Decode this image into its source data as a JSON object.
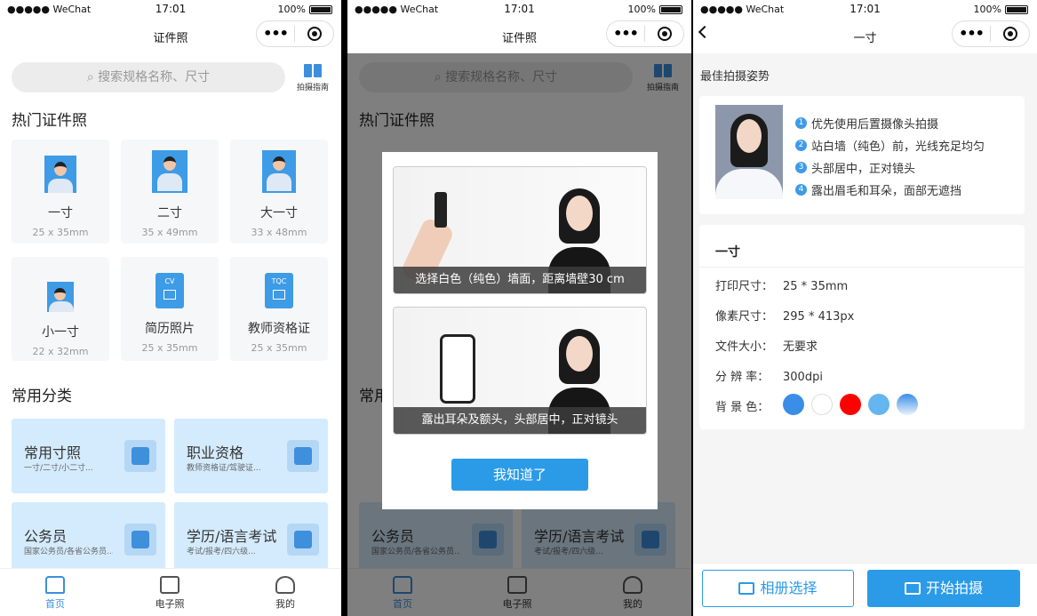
{
  "status": {
    "signal": "●●●●● WeChat",
    "time": "17:01",
    "battery": "100%"
  },
  "home": {
    "nav_title": "证件照",
    "search_placeholder": "搜索规格名称、尺寸",
    "guide_label": "拍摄指南",
    "hot_title": "热门证件照",
    "hot_items": [
      {
        "name": "一寸",
        "size": "25 x 35mm"
      },
      {
        "name": "二寸",
        "size": "35 x 49mm"
      },
      {
        "name": "大一寸",
        "size": "33 x 48mm"
      },
      {
        "name": "小一寸",
        "size": "22 x 32mm"
      },
      {
        "name": "简历照片",
        "size": "25 x 35mm",
        "badge": "CV"
      },
      {
        "name": "教师资格证",
        "size": "25 x 35mm",
        "badge": "TQC"
      }
    ],
    "cat_title": "常用分类",
    "categories": [
      {
        "title": "常用寸照",
        "sub": "一寸/二寸/小二寸..."
      },
      {
        "title": "职业资格",
        "sub": "教师资格证/驾驶证..."
      },
      {
        "title": "公务员",
        "sub": "国家公务员/各省公务员..."
      },
      {
        "title": "学历/语言考试",
        "sub": "考试/报考/四六级..."
      }
    ],
    "tabs": [
      "首页",
      "电子照",
      "我的"
    ]
  },
  "modal": {
    "caption1": "选择白色（纯色）墙面，距离墙壁30 cm",
    "caption2": "露出耳朵及额头，头部居中，正对镜头",
    "ok_label": "我知道了"
  },
  "detail": {
    "nav_title": "一寸",
    "pose_title": "最佳拍摄姿势",
    "tips": [
      "优先使用后置摄像头拍摄",
      "站白墙（纯色）前，光线充足均匀",
      "头部居中，正对镜头",
      "露出眉毛和耳朵，面部无遮挡"
    ],
    "spec_title": "一寸",
    "specs": [
      {
        "k": "打印尺寸：",
        "v": "25 * 35mm"
      },
      {
        "k": "像素尺寸：",
        "v": "295 * 413px"
      },
      {
        "k": "文件大小：",
        "v": "无要求"
      },
      {
        "k": "分 辨 率：",
        "v": "300dpi"
      },
      {
        "k": "背 景 色：",
        "v": ""
      }
    ],
    "bg_colors": [
      "#3a8ee6",
      "#ffffff",
      "#ff0000",
      "#64b5f0",
      "#5a9be6"
    ],
    "album_label": "相册选择",
    "shoot_label": "开始拍摄"
  }
}
